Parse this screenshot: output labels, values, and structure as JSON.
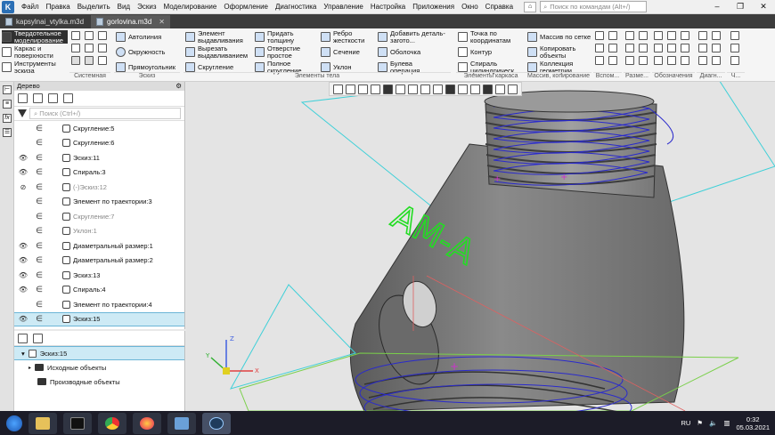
{
  "menu": {
    "items": [
      "Файл",
      "Правка",
      "Выделить",
      "Вид",
      "Эскиз",
      "Моделирование",
      "Оформление",
      "Диагностика",
      "Управление",
      "Настройка",
      "Приложения",
      "Окно",
      "Справка"
    ],
    "search_placeholder": "Поиск по командам (Alt+/)"
  },
  "tabs": [
    {
      "label": "kapsylnai_vtylka.m3d"
    },
    {
      "label": "gorlovina.m3d"
    }
  ],
  "ribbon": {
    "modes": [
      "Твердотельное моделирование",
      "Каркас и поверхности",
      "Инструменты эскиза"
    ],
    "system": {
      "group": "Системная"
    },
    "sketch": {
      "items": [
        "Автолиния",
        "Окружность",
        "Прямоугольник"
      ],
      "group": "Эскиз"
    },
    "body": {
      "col1": [
        "Элемент выдавливания",
        "Вырезать выдавливанием",
        "Скругление"
      ],
      "col2": [
        "Придать толщину",
        "Отверстие простое",
        "Полное скругление"
      ],
      "col3": [
        "Ребро жесткости",
        "Сечение",
        "Уклон"
      ],
      "col4": [
        "Добавить деталь-загото...",
        "Оболочка",
        "Булева операция"
      ],
      "group": "Элементы тела"
    },
    "frame": {
      "items": [
        "Точка по координатам",
        "Контур",
        "Спираль цилиндрическ..."
      ],
      "group": "Элементы каркаса"
    },
    "array": {
      "items": [
        "Массив по сетке",
        "Копировать объекты",
        "Коллекция геометрии"
      ],
      "group": "Массив, копирование"
    },
    "small_groups": [
      "Вспом...",
      "Разме...",
      "Обозначения",
      "Диагн...",
      "Ч..."
    ]
  },
  "tree": {
    "title": "Дерево",
    "search_placeholder": "Поиск (Ctrl+/)",
    "items": [
      {
        "label": "Скругление:5",
        "eye": "",
        "dim": false
      },
      {
        "label": "Скругление:6",
        "eye": "",
        "dim": false
      },
      {
        "label": "Эскиз:11",
        "eye": "👁",
        "dim": false
      },
      {
        "label": "Спираль:3",
        "eye": "👁",
        "dim": false
      },
      {
        "label": "(-)Эскиз:12",
        "eye": "⊘",
        "dim": true
      },
      {
        "label": "Элемент по траектории:3",
        "eye": "",
        "dim": false
      },
      {
        "label": "Скругление:7",
        "eye": "",
        "dim": true
      },
      {
        "label": "Уклон:1",
        "eye": "",
        "dim": true
      },
      {
        "label": "Диаметральный размер:1",
        "eye": "👁",
        "dim": false
      },
      {
        "label": "Диаметральный размер:2",
        "eye": "👁",
        "dim": false
      },
      {
        "label": "Эскиз:13",
        "eye": "👁",
        "dim": false
      },
      {
        "label": "Спираль:4",
        "eye": "👁",
        "dim": false
      },
      {
        "label": "Элемент по траектории:4",
        "eye": "",
        "dim": false
      },
      {
        "label": "Эскиз:15",
        "eye": "👁",
        "dim": false,
        "selected": true
      }
    ],
    "bottom": [
      {
        "label": "Эскиз:15",
        "selected": true
      },
      {
        "label": "Исходные объекты"
      },
      {
        "label": "Производные объекты"
      }
    ]
  },
  "viewport": {
    "engraving": "АМ-А"
  },
  "taskbar": {
    "lang": "RU",
    "time": "0:32",
    "date": "05.03.2021"
  },
  "colors": {
    "accent": "#2b6fb5",
    "thread": "#2a2acc",
    "plane_cyan": "#3fd0d8",
    "plane_green": "#7ad04a",
    "engrave": "#22dd22",
    "body": "#7c7c7c"
  }
}
